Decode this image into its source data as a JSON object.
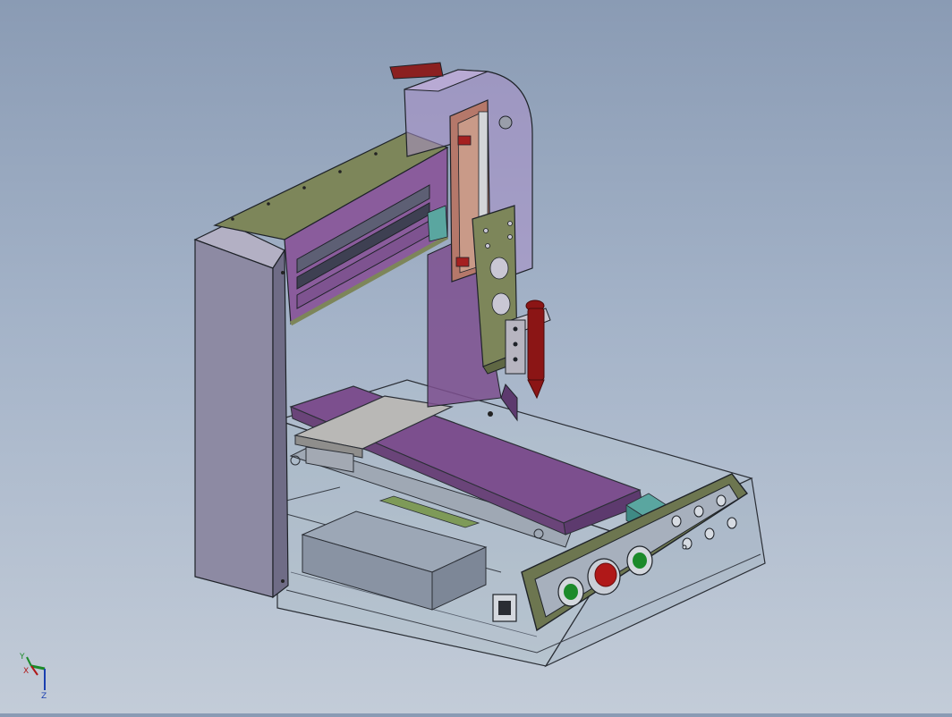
{
  "viewport": {
    "background_top": "#8a9bb4",
    "background_bottom": "#c3ccd8"
  },
  "colors": {
    "frame_panel": "#8d8aa3",
    "beam_top": "#7d865a",
    "carriage_purple": "#7c4f8e",
    "transparent_housing": "#a98fc9",
    "syringe_red": "#8b1515",
    "button_green": "#1c8a2a",
    "button_red": "#b01818",
    "rail_teal": "#5aa6a0",
    "panel_olive": "#6d7650"
  },
  "triad": {
    "axis_y": "Y",
    "axis_x": "X",
    "axis_z": "Z"
  }
}
